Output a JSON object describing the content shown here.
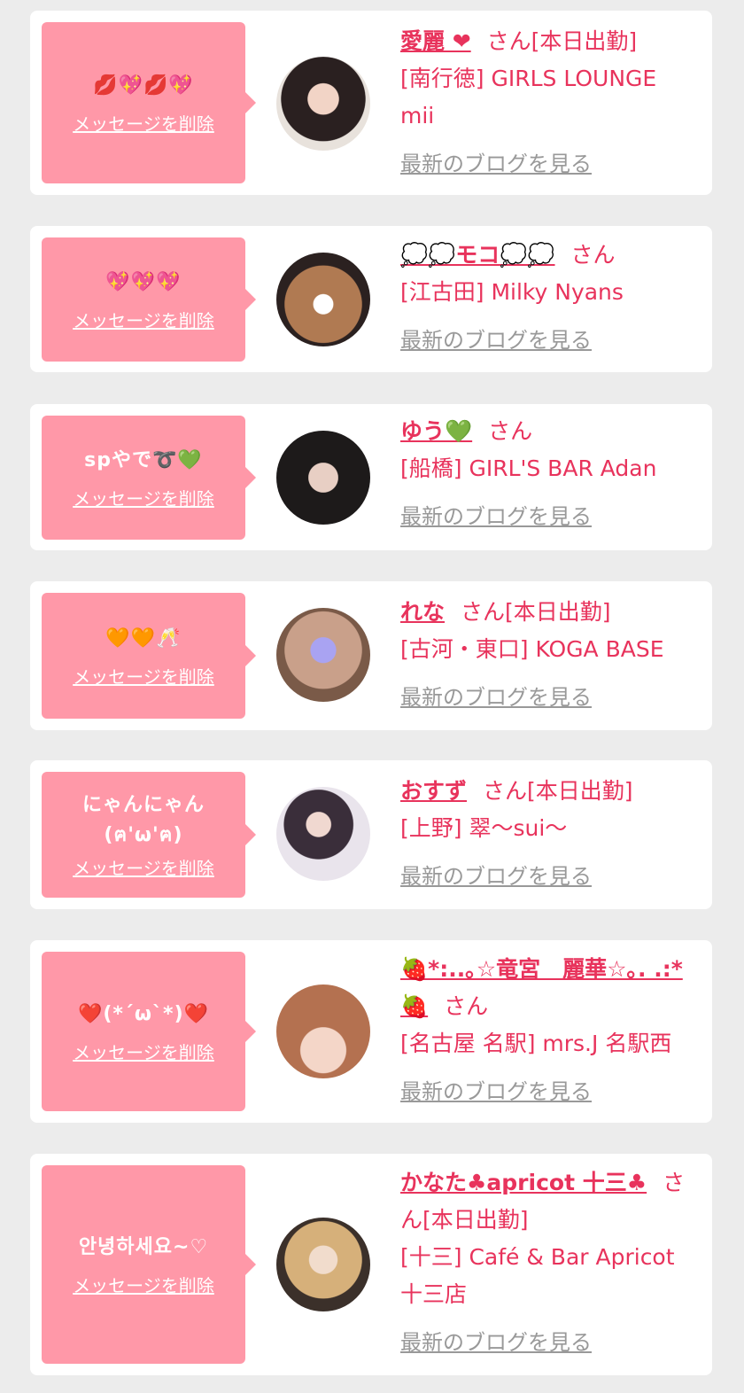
{
  "delete_label": "メッセージを削除",
  "blog_label": "最新のブログを見る",
  "san": "さん",
  "entries": [
    {
      "message": "💋💖💋💖",
      "name": "愛麗 ❤",
      "status": "[本日出勤]",
      "store": "[南行徳] GIRLS LOUNGE mii"
    },
    {
      "message": "💖💖💖",
      "name": "💭💭モコ💭💭",
      "status": "",
      "store": "[江古田] Milky Nyans"
    },
    {
      "message": "spやで➰💚",
      "name": "ゆう💚",
      "status": "",
      "store": "[船橋] GIRL'S BAR Adan"
    },
    {
      "message": "🧡🧡🥂",
      "name": "れな",
      "status": "[本日出勤]",
      "store": "[古河・東口] KOGA BASE"
    },
    {
      "message": "にゃんにゃん\n(ฅ'ω'ฅ)",
      "name": "おすず",
      "status": "[本日出勤]",
      "store": "[上野] 翠〜sui〜"
    },
    {
      "message": "❤️(*´ω`*)❤️",
      "name": "🍓*:..｡☆竜宮　麗華☆｡. .:*🍓",
      "status": "",
      "store": "[名古屋 名駅] mrs.J 名駅西"
    },
    {
      "message": "안녕하세요~♡",
      "name": "かなた♣apricot 十三♣",
      "status": "[本日出勤]",
      "store": "[十三] Café & Bar Apricot 十三店"
    }
  ]
}
